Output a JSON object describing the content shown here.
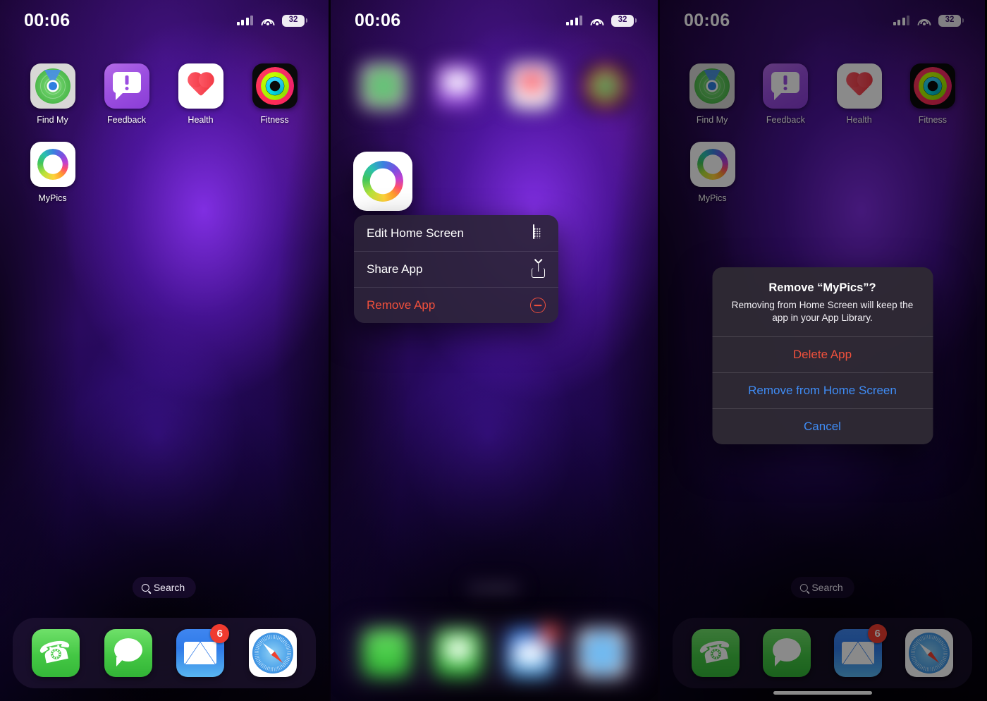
{
  "status_bar": {
    "time": "00:06",
    "battery_level": "32",
    "icons": {
      "cellular": "cellular-bars-icon",
      "wifi": "wifi-icon",
      "battery": "battery-icon"
    }
  },
  "home_screen": {
    "apps": [
      {
        "name": "Find My",
        "icon": "find-my-icon"
      },
      {
        "name": "Feedback",
        "icon": "feedback-icon"
      },
      {
        "name": "Health",
        "icon": "health-icon"
      },
      {
        "name": "Fitness",
        "icon": "fitness-icon"
      },
      {
        "name": "MyPics",
        "icon": "mypics-icon"
      }
    ],
    "search": {
      "label": "Search",
      "icon": "search-icon"
    },
    "dock": [
      {
        "name": "Phone",
        "icon": "phone-icon",
        "badge": ""
      },
      {
        "name": "Messages",
        "icon": "messages-icon",
        "badge": ""
      },
      {
        "name": "Mail",
        "icon": "mail-icon",
        "badge": "6"
      },
      {
        "name": "Safari",
        "icon": "safari-icon",
        "badge": ""
      }
    ]
  },
  "context_menu": {
    "target_app": "MyPics",
    "items": [
      {
        "label": "Edit Home Screen",
        "icon": "home-screen-grid-icon",
        "style": "normal"
      },
      {
        "label": "Share App",
        "icon": "share-icon",
        "style": "normal"
      },
      {
        "label": "Remove App",
        "icon": "minus-circle-icon",
        "style": "destructive"
      }
    ]
  },
  "alert": {
    "title": "Remove “MyPics”?",
    "message": "Removing from Home Screen will keep the app in your App Library.",
    "buttons": [
      {
        "label": "Delete App",
        "style": "destructive"
      },
      {
        "label": "Remove from Home Screen",
        "style": "primary"
      },
      {
        "label": "Cancel",
        "style": "cancel"
      }
    ]
  },
  "colors": {
    "destructive": "#f0503c",
    "primary": "#3f8cf5",
    "badge": "#f03b2f",
    "wallpaper": "#2a0a5c"
  }
}
